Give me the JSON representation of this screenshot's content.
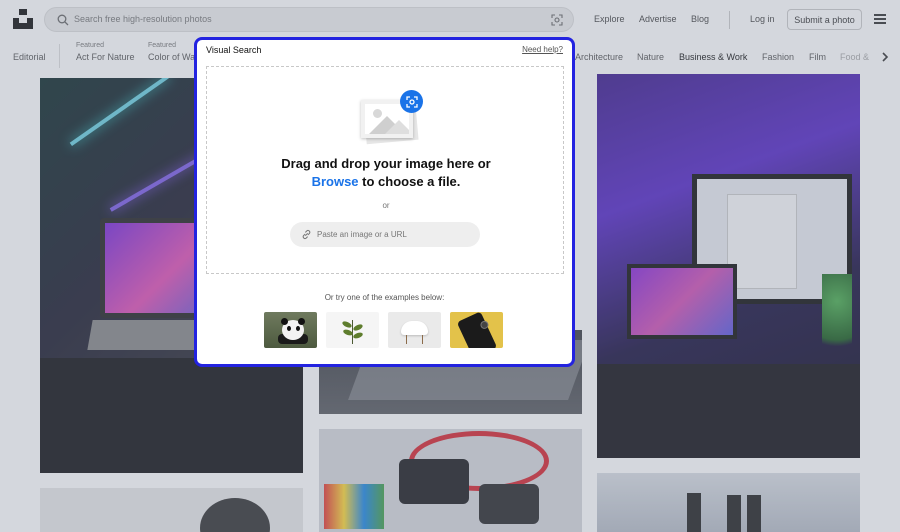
{
  "header": {
    "search_placeholder": "Search free high-resolution photos",
    "nav": {
      "explore": "Explore",
      "advertise": "Advertise",
      "blog": "Blog",
      "login": "Log in",
      "submit": "Submit a photo"
    }
  },
  "categories": {
    "editorial": "Editorial",
    "featured_label": "Featured",
    "act_for_nature": "Act For Nature",
    "color_of_water": "Color of Wa",
    "architecture": "Architecture",
    "nature": "Nature",
    "business_work": "Business & Work",
    "fashion": "Fashion",
    "film": "Film",
    "food": "Food &"
  },
  "modal": {
    "title": "Visual Search",
    "help": "Need help?",
    "drop_line1": "Drag and drop your image here or",
    "browse": "Browse",
    "drop_line2_rest": " to choose a file.",
    "or": "or",
    "url_placeholder": "Paste an image or a URL",
    "examples_label": "Or try one of the examples below:"
  },
  "colors": {
    "accent": "#1a73e8",
    "modal_border": "#2323e0"
  }
}
